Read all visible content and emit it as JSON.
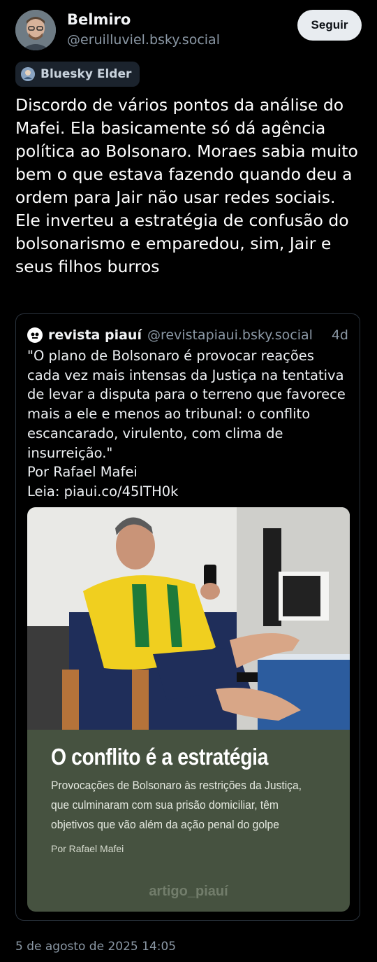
{
  "author": {
    "name": "Belmiro",
    "handle": "@eruilluviel.bsky.social",
    "avatar_icon": "user-avatar-photo"
  },
  "follow_label": "Seguir",
  "badge": {
    "label": "Bluesky Elder",
    "icon": "elder-badge-icon"
  },
  "post_text": "Discordo de vários pontos da análise do Mafei. Ela basicamente só dá agência política ao Bolsonaro. Moraes sabia muito bem o que estava fazendo quando deu a ordem para Jair não usar redes sociais. Ele inverteu a estratégia de confusão do bolsonarismo e emparedou, sim, Jair e seus filhos burros",
  "quote": {
    "name": "revista piauí",
    "handle": "@revistapiaui.bsky.social",
    "age": "4d",
    "text": "\"O plano de Bolsonaro é provocar reações cada vez mais intensas da Justiça na tentativa de levar a disputa para o terreno que favorece mais a ele e menos ao tribunal: o conflito escancarado, virulento, com clima de insurreição.\"\nPor Rafael Mafei\nLeia: piaui.co/45ITH0k",
    "embed": {
      "title": "O conflito é a estratégia",
      "description": "Provocações de Bolsonaro às restrições da Justiça, que culminaram com sua prisão domiciliar, têm objetivos que vão além da ação penal do golpe",
      "author": "Por Rafael Mafei",
      "brand": "artigo_piauí"
    }
  },
  "timestamp": "5 de agosto de 2025 14:05",
  "colors": {
    "background": "#000000",
    "secondary_text": "#8b98a5",
    "follow_button": "#e8ecf0",
    "embed_card": "#465240"
  }
}
